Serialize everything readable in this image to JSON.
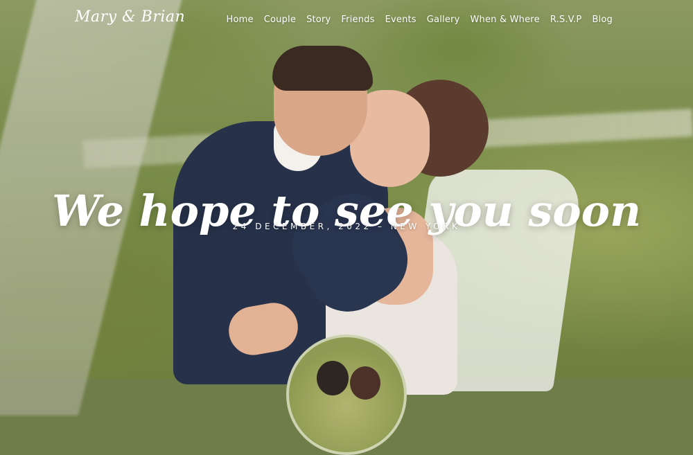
{
  "site": {
    "logo": "Mary & Brian"
  },
  "nav": {
    "items": [
      "Home",
      "Couple",
      "Story",
      "Friends",
      "Events",
      "Gallery",
      "When & Where",
      "R.S.V.P",
      "Blog"
    ]
  },
  "hero": {
    "title": "We hope to see you soon",
    "subtitle": "24 DECEMBER, 2022 – NEW YORK"
  },
  "colors": {
    "text": "#ffffff"
  }
}
